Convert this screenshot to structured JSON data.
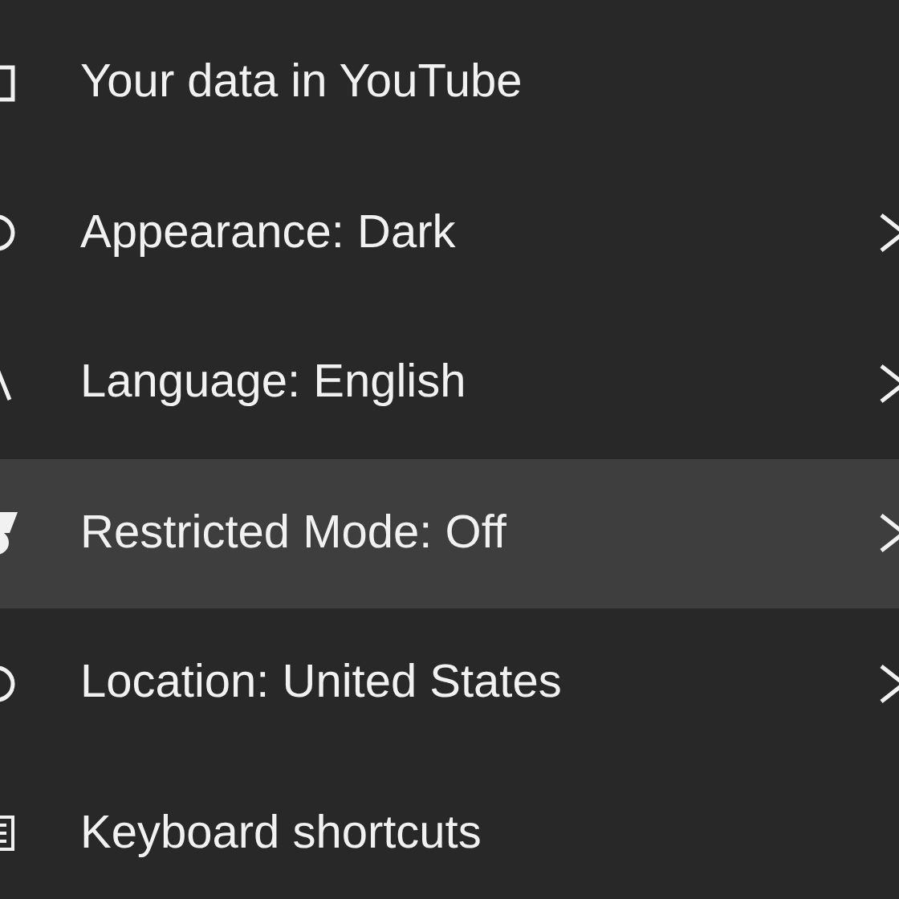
{
  "menu_items": [
    {
      "label": "Your data in YouTube",
      "has_submenu": false,
      "selected": false
    },
    {
      "label": "Appearance: Dark",
      "has_submenu": true,
      "selected": false
    },
    {
      "label": "Language: English",
      "has_submenu": true,
      "selected": false
    },
    {
      "label": "Restricted Mode: Off",
      "has_submenu": true,
      "selected": true
    },
    {
      "label": "Location: United States",
      "has_submenu": true,
      "selected": false
    },
    {
      "label": "Keyboard shortcuts",
      "has_submenu": false,
      "selected": false
    }
  ]
}
